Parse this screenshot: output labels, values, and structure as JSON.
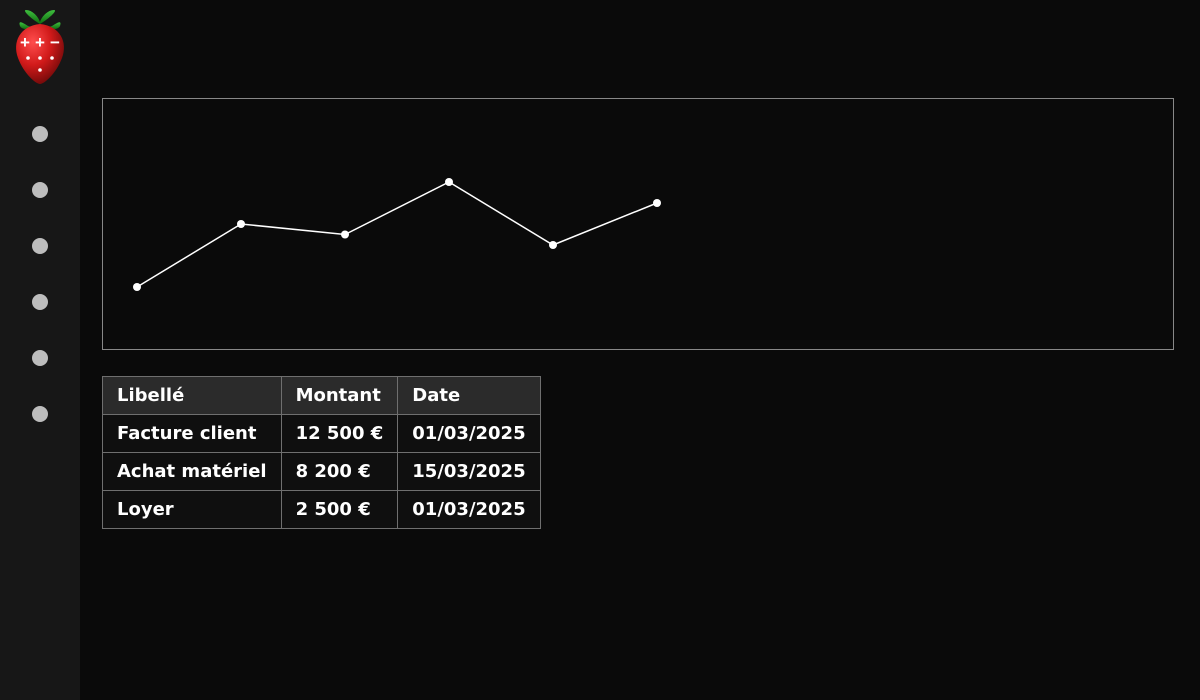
{
  "sidebar": {
    "nav_items": [
      {
        "name": "nav-item-0"
      },
      {
        "name": "nav-item-1"
      },
      {
        "name": "nav-item-2"
      },
      {
        "name": "nav-item-3"
      },
      {
        "name": "nav-item-4"
      },
      {
        "name": "nav-item-5"
      }
    ]
  },
  "chart_data": {
    "type": "line",
    "x": [
      0,
      1,
      2,
      3,
      4,
      5
    ],
    "values": [
      20,
      50,
      45,
      70,
      40,
      60
    ],
    "ylim": [
      0,
      100
    ],
    "title": "",
    "xlabel": "",
    "ylabel": ""
  },
  "table": {
    "columns": [
      "Libellé",
      "Montant",
      "Date"
    ],
    "rows": [
      {
        "label": "Facture client",
        "amount": "12 500 €",
        "date": "01/03/2025"
      },
      {
        "label": "Achat matériel",
        "amount": "8 200 €",
        "date": "15/03/2025"
      },
      {
        "label": "Loyer",
        "amount": "2 500 €",
        "date": "01/03/2025"
      }
    ]
  },
  "colors": {
    "border": "#888888",
    "line": "#ffffff",
    "dot": "#ffffff",
    "nav_dot": "#bdbdbd"
  }
}
